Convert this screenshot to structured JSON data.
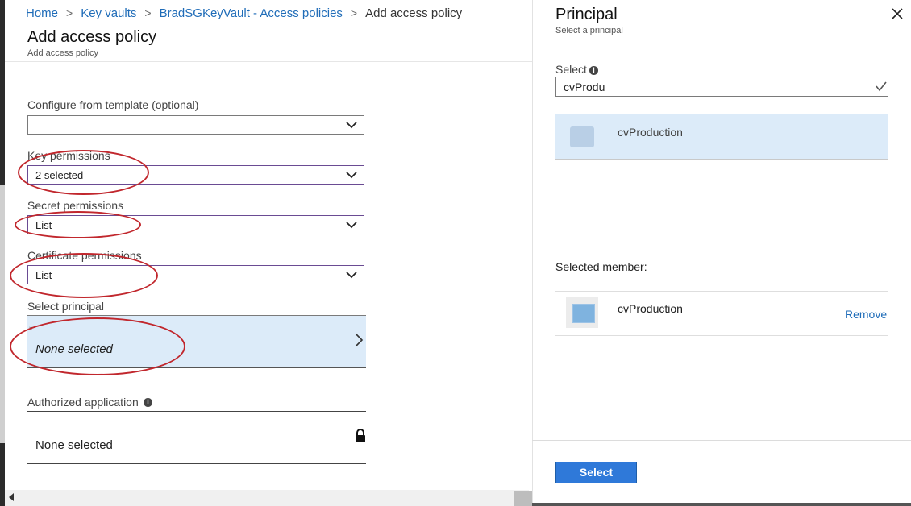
{
  "breadcrumb": {
    "items": [
      "Home",
      "Key vaults",
      "BradSGKeyVault - Access policies"
    ],
    "current": "Add access policy",
    "separator": ">"
  },
  "page": {
    "title": "Add access policy",
    "subtitle": "Add access policy"
  },
  "form": {
    "template": {
      "label": "Configure from template (optional)",
      "value": ""
    },
    "key_permissions": {
      "label": "Key permissions",
      "value": "2 selected"
    },
    "secret_permissions": {
      "label": "Secret permissions",
      "value": "List"
    },
    "certificate_permissions": {
      "label": "Certificate permissions",
      "value": "List"
    },
    "principal": {
      "label": "Select principal",
      "required_mark": "*",
      "value": "None selected"
    },
    "authorized_application": {
      "label": "Authorized application",
      "value": "None selected"
    }
  },
  "panel": {
    "title": "Principal",
    "subtitle": "Select a principal",
    "select_label": "Select",
    "search_value": "cvProdu",
    "results": [
      {
        "name": "cvProduction"
      }
    ],
    "selected_member_label": "Selected member:",
    "selected_members": [
      {
        "name": "cvProduction",
        "remove_label": "Remove"
      }
    ],
    "select_button": "Select"
  },
  "colors": {
    "accent": "#2f79d9",
    "link": "#1f6cb8",
    "highlight": "#dcebf9",
    "annotation": "#c1272d",
    "focus_border": "#6a4b93"
  },
  "icons": [
    "chevron-right-icon",
    "chevron-down-icon",
    "info-icon",
    "lock-icon",
    "close-icon",
    "checkmark-icon"
  ]
}
